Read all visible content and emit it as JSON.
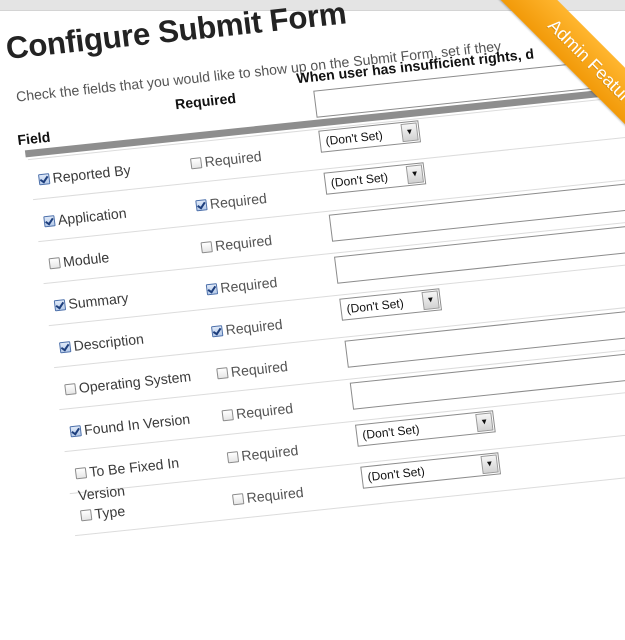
{
  "page": {
    "title": "Configure Submit Form",
    "intro": "Check the fields that you would like to show up on the Submit Form, set if they",
    "ribbon": "Admin Feature"
  },
  "table": {
    "headers": {
      "field": "Field",
      "required": "Required",
      "insufficient": "When user has insufficient rights, d"
    },
    "rows": [
      {
        "field": "Reported By",
        "field_checked": true,
        "required_label": "Required",
        "required_checked": false,
        "control": "select",
        "value": "(Don't Set)"
      },
      {
        "field": "Application",
        "field_checked": true,
        "required_label": "Required",
        "required_checked": true,
        "control": "select",
        "value": "(Don't Set)"
      },
      {
        "field": "Module",
        "field_checked": false,
        "required_label": "Required",
        "required_checked": false,
        "control": "text",
        "value": ""
      },
      {
        "field": "Summary",
        "field_checked": true,
        "required_label": "Required",
        "required_checked": true,
        "control": "text",
        "value": ""
      },
      {
        "field": "Description",
        "field_checked": true,
        "required_label": "Required",
        "required_checked": true,
        "control": "select",
        "value": "(Don't Set)"
      },
      {
        "field": "Operating System",
        "field_checked": false,
        "required_label": "Required",
        "required_checked": false,
        "control": "text",
        "value": ""
      },
      {
        "field": "Found In Version",
        "field_checked": true,
        "required_label": "Required",
        "required_checked": false,
        "control": "text",
        "value": ""
      },
      {
        "field": "To Be Fixed In Version",
        "field_checked": false,
        "required_label": "Required",
        "required_checked": false,
        "control": "select",
        "value": "(Don't Set)"
      },
      {
        "field": "Type",
        "field_checked": false,
        "required_label": "Required",
        "required_checked": false,
        "control": "select",
        "value": "(Don't Set)"
      }
    ]
  },
  "colors": {
    "ribbon": "#f5a417",
    "header_rule": "#8e8e8e",
    "checkbox_on": "#4b6faa"
  }
}
